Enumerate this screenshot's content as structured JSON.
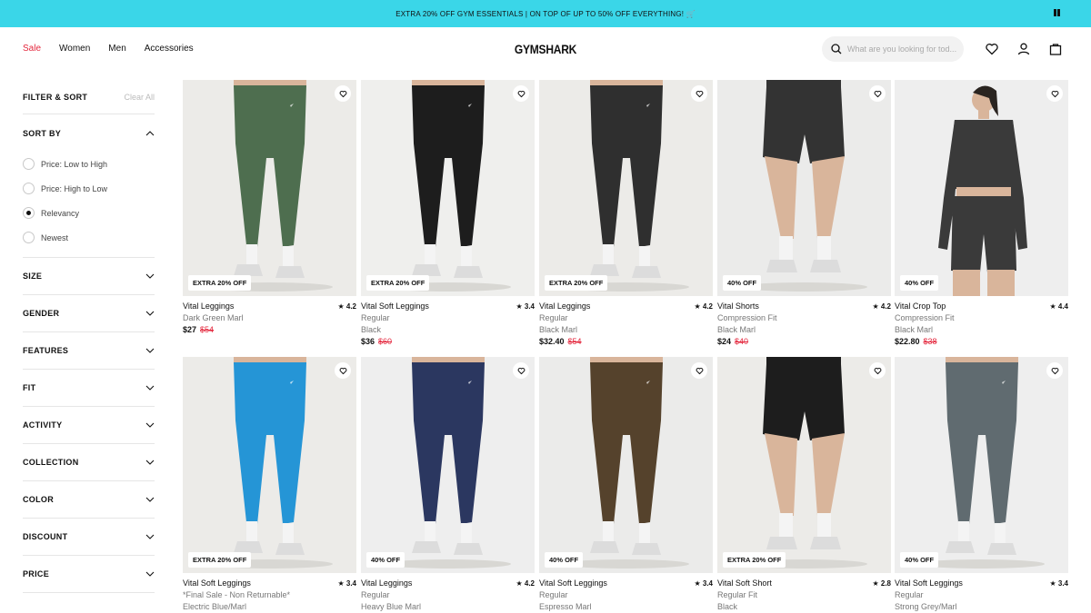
{
  "promo": {
    "text": "EXTRA 20% OFF GYM ESSENTIALS | ON TOP OF UP TO 50% OFF EVERYTHING! 🛒"
  },
  "header": {
    "nav": [
      "Sale",
      "Women",
      "Men",
      "Accessories"
    ],
    "logo": "GYMSHARK",
    "search_placeholder": "What are you looking for tod..."
  },
  "sidebar": {
    "title": "FILTER & SORT",
    "clear": "Clear All",
    "sort_label": "SORT BY",
    "sort_options": [
      "Price: Low to High",
      "Price: High to Low",
      "Relevancy",
      "Newest"
    ],
    "sort_selected": "Relevancy",
    "filters": [
      "SIZE",
      "GENDER",
      "FEATURES",
      "FIT",
      "ACTIVITY",
      "COLLECTION",
      "COLOR",
      "DISCOUNT",
      "PRICE"
    ]
  },
  "products": [
    {
      "name": "Vital Leggings",
      "rating": "★ 4.2",
      "variant": "Dark Green Marl",
      "color": "",
      "price": "$27",
      "was": "$54",
      "badge": "EXTRA 20% OFF",
      "garment": "leggings",
      "tone": "#4e6e4f",
      "bg": "#ecebe8"
    },
    {
      "name": "Vital Soft Leggings",
      "rating": "★ 3.4",
      "variant": "Regular",
      "color": "Black",
      "price": "$36",
      "was": "$60",
      "badge": "EXTRA 20% OFF",
      "garment": "leggings",
      "tone": "#1d1d1d",
      "bg": "#efefed"
    },
    {
      "name": "Vital Leggings",
      "rating": "★ 4.2",
      "variant": "Regular",
      "color": "Black Marl",
      "price": "$32.40",
      "was": "$54",
      "badge": "EXTRA 20% OFF",
      "garment": "leggings",
      "tone": "#2f2f2f",
      "bg": "#ecebe8"
    },
    {
      "name": "Vital Shorts",
      "rating": "★ 4.2",
      "variant": "Compression Fit",
      "color": "Black Marl",
      "price": "$24",
      "was": "$40",
      "badge": "40% OFF",
      "garment": "shorts",
      "tone": "#333333",
      "bg": "#ebebea"
    },
    {
      "name": "Vital Crop Top",
      "rating": "★ 4.4",
      "variant": "Compression Fit",
      "color": "Black Marl",
      "price": "$22.80",
      "was": "$38",
      "badge": "40% OFF",
      "garment": "top",
      "tone": "#3a3a3a",
      "bg": "#eeeeee"
    },
    {
      "name": "Vital Soft Leggings",
      "rating": "★ 3.4",
      "variant": "*Final Sale - Non Returnable*",
      "color": "Electric Blue/Marl",
      "price": "",
      "was": "",
      "badge": "EXTRA 20% OFF",
      "garment": "leggings",
      "tone": "#2595d6",
      "bg": "#ecebe8"
    },
    {
      "name": "Vital Leggings",
      "rating": "★ 4.2",
      "variant": "Regular",
      "color": "Heavy Blue Marl",
      "price": "",
      "was": "",
      "badge": "40% OFF",
      "garment": "leggings",
      "tone": "#2b3760",
      "bg": "#eeeeee"
    },
    {
      "name": "Vital Soft Leggings",
      "rating": "★ 3.4",
      "variant": "Regular",
      "color": "Espresso Marl",
      "price": "",
      "was": "",
      "badge": "40% OFF",
      "garment": "leggings",
      "tone": "#55422c",
      "bg": "#ebebea"
    },
    {
      "name": "Vital Soft Short",
      "rating": "★ 2.8",
      "variant": "Regular Fit",
      "color": "Black",
      "price": "",
      "was": "",
      "badge": "EXTRA 20% OFF",
      "garment": "shorts",
      "tone": "#1d1d1d",
      "bg": "#ecebe8"
    },
    {
      "name": "Vital Soft Leggings",
      "rating": "★ 3.4",
      "variant": "Regular",
      "color": "Strong Grey/Marl",
      "price": "",
      "was": "",
      "badge": "40% OFF",
      "garment": "leggings",
      "tone": "#606b70",
      "bg": "#eeeeee"
    }
  ]
}
